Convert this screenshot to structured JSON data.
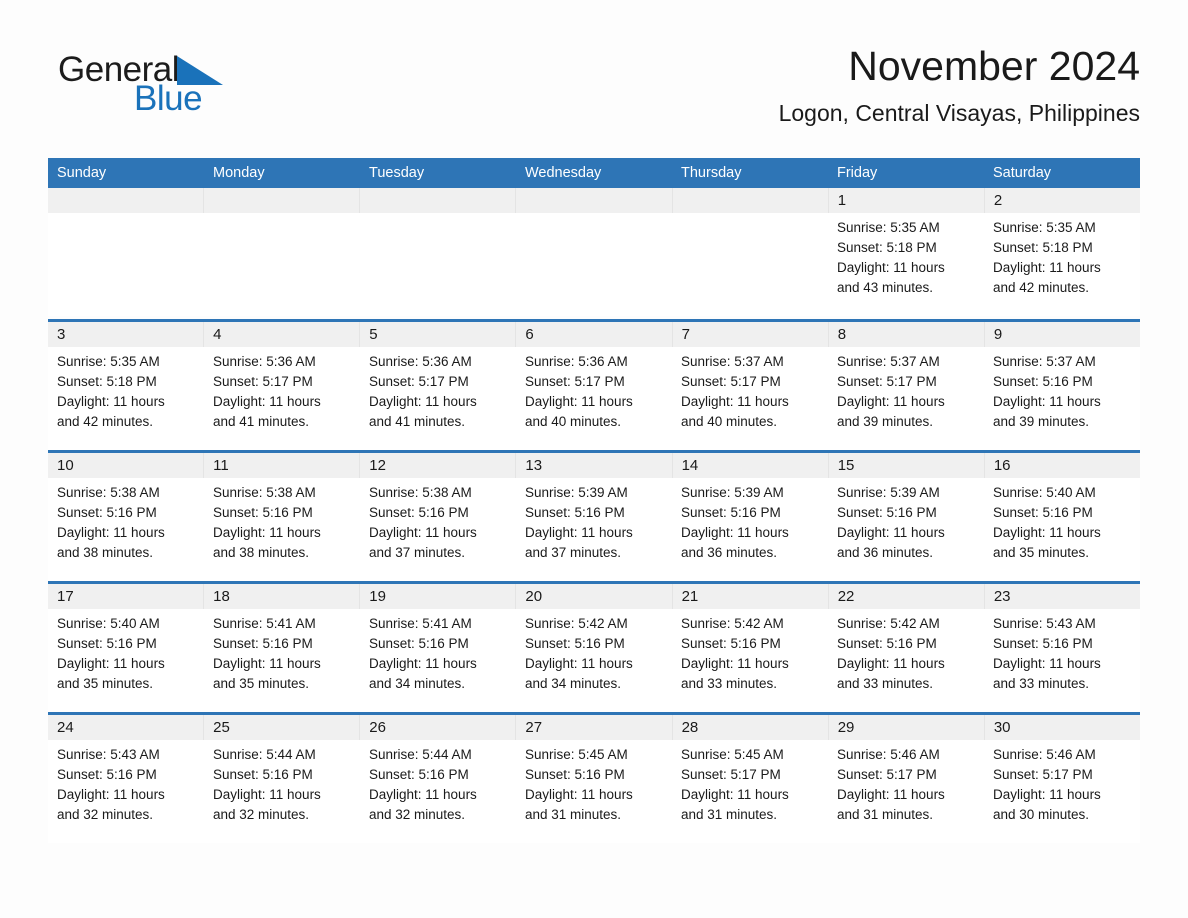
{
  "brand": {
    "name_part1": "General",
    "name_part2": "Blue",
    "logo_icon": "blue-triangle-mark"
  },
  "header": {
    "title": "November 2024",
    "subtitle": "Logon, Central Visayas, Philippines"
  },
  "theme": {
    "header_blue": "#2e75b6",
    "daynum_band_gray": "#f0f0f0",
    "brand_blue": "#1a72ba",
    "text_dark": "#1a1a1a",
    "page_background": "#fdfdfd"
  },
  "calendar": {
    "weekdays": [
      "Sunday",
      "Monday",
      "Tuesday",
      "Wednesday",
      "Thursday",
      "Friday",
      "Saturday"
    ],
    "weeks": [
      [
        {
          "day": "",
          "lines": []
        },
        {
          "day": "",
          "lines": []
        },
        {
          "day": "",
          "lines": []
        },
        {
          "day": "",
          "lines": []
        },
        {
          "day": "",
          "lines": []
        },
        {
          "day": "1",
          "lines": [
            "Sunrise: 5:35 AM",
            "Sunset: 5:18 PM",
            "Daylight: 11 hours",
            "and 43 minutes."
          ]
        },
        {
          "day": "2",
          "lines": [
            "Sunrise: 5:35 AM",
            "Sunset: 5:18 PM",
            "Daylight: 11 hours",
            "and 42 minutes."
          ]
        }
      ],
      [
        {
          "day": "3",
          "lines": [
            "Sunrise: 5:35 AM",
            "Sunset: 5:18 PM",
            "Daylight: 11 hours",
            "and 42 minutes."
          ]
        },
        {
          "day": "4",
          "lines": [
            "Sunrise: 5:36 AM",
            "Sunset: 5:17 PM",
            "Daylight: 11 hours",
            "and 41 minutes."
          ]
        },
        {
          "day": "5",
          "lines": [
            "Sunrise: 5:36 AM",
            "Sunset: 5:17 PM",
            "Daylight: 11 hours",
            "and 41 minutes."
          ]
        },
        {
          "day": "6",
          "lines": [
            "Sunrise: 5:36 AM",
            "Sunset: 5:17 PM",
            "Daylight: 11 hours",
            "and 40 minutes."
          ]
        },
        {
          "day": "7",
          "lines": [
            "Sunrise: 5:37 AM",
            "Sunset: 5:17 PM",
            "Daylight: 11 hours",
            "and 40 minutes."
          ]
        },
        {
          "day": "8",
          "lines": [
            "Sunrise: 5:37 AM",
            "Sunset: 5:17 PM",
            "Daylight: 11 hours",
            "and 39 minutes."
          ]
        },
        {
          "day": "9",
          "lines": [
            "Sunrise: 5:37 AM",
            "Sunset: 5:16 PM",
            "Daylight: 11 hours",
            "and 39 minutes."
          ]
        }
      ],
      [
        {
          "day": "10",
          "lines": [
            "Sunrise: 5:38 AM",
            "Sunset: 5:16 PM",
            "Daylight: 11 hours",
            "and 38 minutes."
          ]
        },
        {
          "day": "11",
          "lines": [
            "Sunrise: 5:38 AM",
            "Sunset: 5:16 PM",
            "Daylight: 11 hours",
            "and 38 minutes."
          ]
        },
        {
          "day": "12",
          "lines": [
            "Sunrise: 5:38 AM",
            "Sunset: 5:16 PM",
            "Daylight: 11 hours",
            "and 37 minutes."
          ]
        },
        {
          "day": "13",
          "lines": [
            "Sunrise: 5:39 AM",
            "Sunset: 5:16 PM",
            "Daylight: 11 hours",
            "and 37 minutes."
          ]
        },
        {
          "day": "14",
          "lines": [
            "Sunrise: 5:39 AM",
            "Sunset: 5:16 PM",
            "Daylight: 11 hours",
            "and 36 minutes."
          ]
        },
        {
          "day": "15",
          "lines": [
            "Sunrise: 5:39 AM",
            "Sunset: 5:16 PM",
            "Daylight: 11 hours",
            "and 36 minutes."
          ]
        },
        {
          "day": "16",
          "lines": [
            "Sunrise: 5:40 AM",
            "Sunset: 5:16 PM",
            "Daylight: 11 hours",
            "and 35 minutes."
          ]
        }
      ],
      [
        {
          "day": "17",
          "lines": [
            "Sunrise: 5:40 AM",
            "Sunset: 5:16 PM",
            "Daylight: 11 hours",
            "and 35 minutes."
          ]
        },
        {
          "day": "18",
          "lines": [
            "Sunrise: 5:41 AM",
            "Sunset: 5:16 PM",
            "Daylight: 11 hours",
            "and 35 minutes."
          ]
        },
        {
          "day": "19",
          "lines": [
            "Sunrise: 5:41 AM",
            "Sunset: 5:16 PM",
            "Daylight: 11 hours",
            "and 34 minutes."
          ]
        },
        {
          "day": "20",
          "lines": [
            "Sunrise: 5:42 AM",
            "Sunset: 5:16 PM",
            "Daylight: 11 hours",
            "and 34 minutes."
          ]
        },
        {
          "day": "21",
          "lines": [
            "Sunrise: 5:42 AM",
            "Sunset: 5:16 PM",
            "Daylight: 11 hours",
            "and 33 minutes."
          ]
        },
        {
          "day": "22",
          "lines": [
            "Sunrise: 5:42 AM",
            "Sunset: 5:16 PM",
            "Daylight: 11 hours",
            "and 33 minutes."
          ]
        },
        {
          "day": "23",
          "lines": [
            "Sunrise: 5:43 AM",
            "Sunset: 5:16 PM",
            "Daylight: 11 hours",
            "and 33 minutes."
          ]
        }
      ],
      [
        {
          "day": "24",
          "lines": [
            "Sunrise: 5:43 AM",
            "Sunset: 5:16 PM",
            "Daylight: 11 hours",
            "and 32 minutes."
          ]
        },
        {
          "day": "25",
          "lines": [
            "Sunrise: 5:44 AM",
            "Sunset: 5:16 PM",
            "Daylight: 11 hours",
            "and 32 minutes."
          ]
        },
        {
          "day": "26",
          "lines": [
            "Sunrise: 5:44 AM",
            "Sunset: 5:16 PM",
            "Daylight: 11 hours",
            "and 32 minutes."
          ]
        },
        {
          "day": "27",
          "lines": [
            "Sunrise: 5:45 AM",
            "Sunset: 5:16 PM",
            "Daylight: 11 hours",
            "and 31 minutes."
          ]
        },
        {
          "day": "28",
          "lines": [
            "Sunrise: 5:45 AM",
            "Sunset: 5:17 PM",
            "Daylight: 11 hours",
            "and 31 minutes."
          ]
        },
        {
          "day": "29",
          "lines": [
            "Sunrise: 5:46 AM",
            "Sunset: 5:17 PM",
            "Daylight: 11 hours",
            "and 31 minutes."
          ]
        },
        {
          "day": "30",
          "lines": [
            "Sunrise: 5:46 AM",
            "Sunset: 5:17 PM",
            "Daylight: 11 hours",
            "and 30 minutes."
          ]
        }
      ]
    ]
  }
}
